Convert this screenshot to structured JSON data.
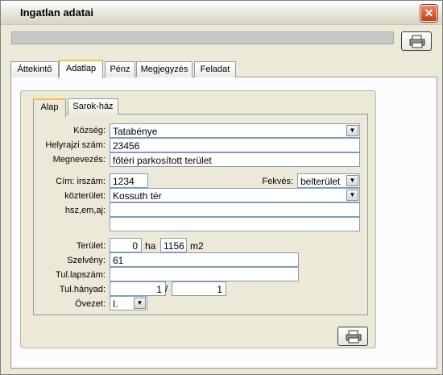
{
  "window": {
    "title": "Ingatlan adatai",
    "close_glyph": "✕"
  },
  "tabs": [
    {
      "label": "Áttekintő"
    },
    {
      "label": "Adatlap"
    },
    {
      "label": "Pénz"
    },
    {
      "label": "Megjegyzés"
    },
    {
      "label": "Feladat"
    }
  ],
  "inner_tabs": [
    {
      "label": "Alap"
    },
    {
      "label": "Sarok-ház"
    }
  ],
  "form": {
    "kozseg": {
      "label": "Község:",
      "value": "Tatabénye"
    },
    "helyrajzi": {
      "label": "Helyrajzi szám:",
      "value": "23456"
    },
    "megnevezes": {
      "label": "Megnevezés:",
      "value": "főtéri parkosított terület"
    },
    "irszam": {
      "label": "Cím: irszám:",
      "value": "1234"
    },
    "fekves": {
      "label": "Fekvés:",
      "value": "belterület"
    },
    "kozterulet": {
      "label": "közterület:",
      "value": "Kossuth tér"
    },
    "hsz": {
      "label": "hsz,em,aj:",
      "value1": "",
      "value2": ""
    },
    "terulet": {
      "label": "Terület:",
      "ha_value": "0",
      "ha_unit": "ha",
      "m2_value": "1156",
      "m2_unit": "m2"
    },
    "szelveny": {
      "label": "Szelvény:",
      "value": "61"
    },
    "tul_lapszam": {
      "label": "Tul.lapszám:",
      "value": ""
    },
    "tul_hanyad": {
      "label": "Tul.hányad:",
      "num": "1",
      "sep": "/",
      "den": "1"
    },
    "ovezet": {
      "label": "Övezet:",
      "value": "I."
    }
  },
  "icons": {
    "printer": "printer-icon",
    "dropdown": "chevron-down-icon"
  }
}
